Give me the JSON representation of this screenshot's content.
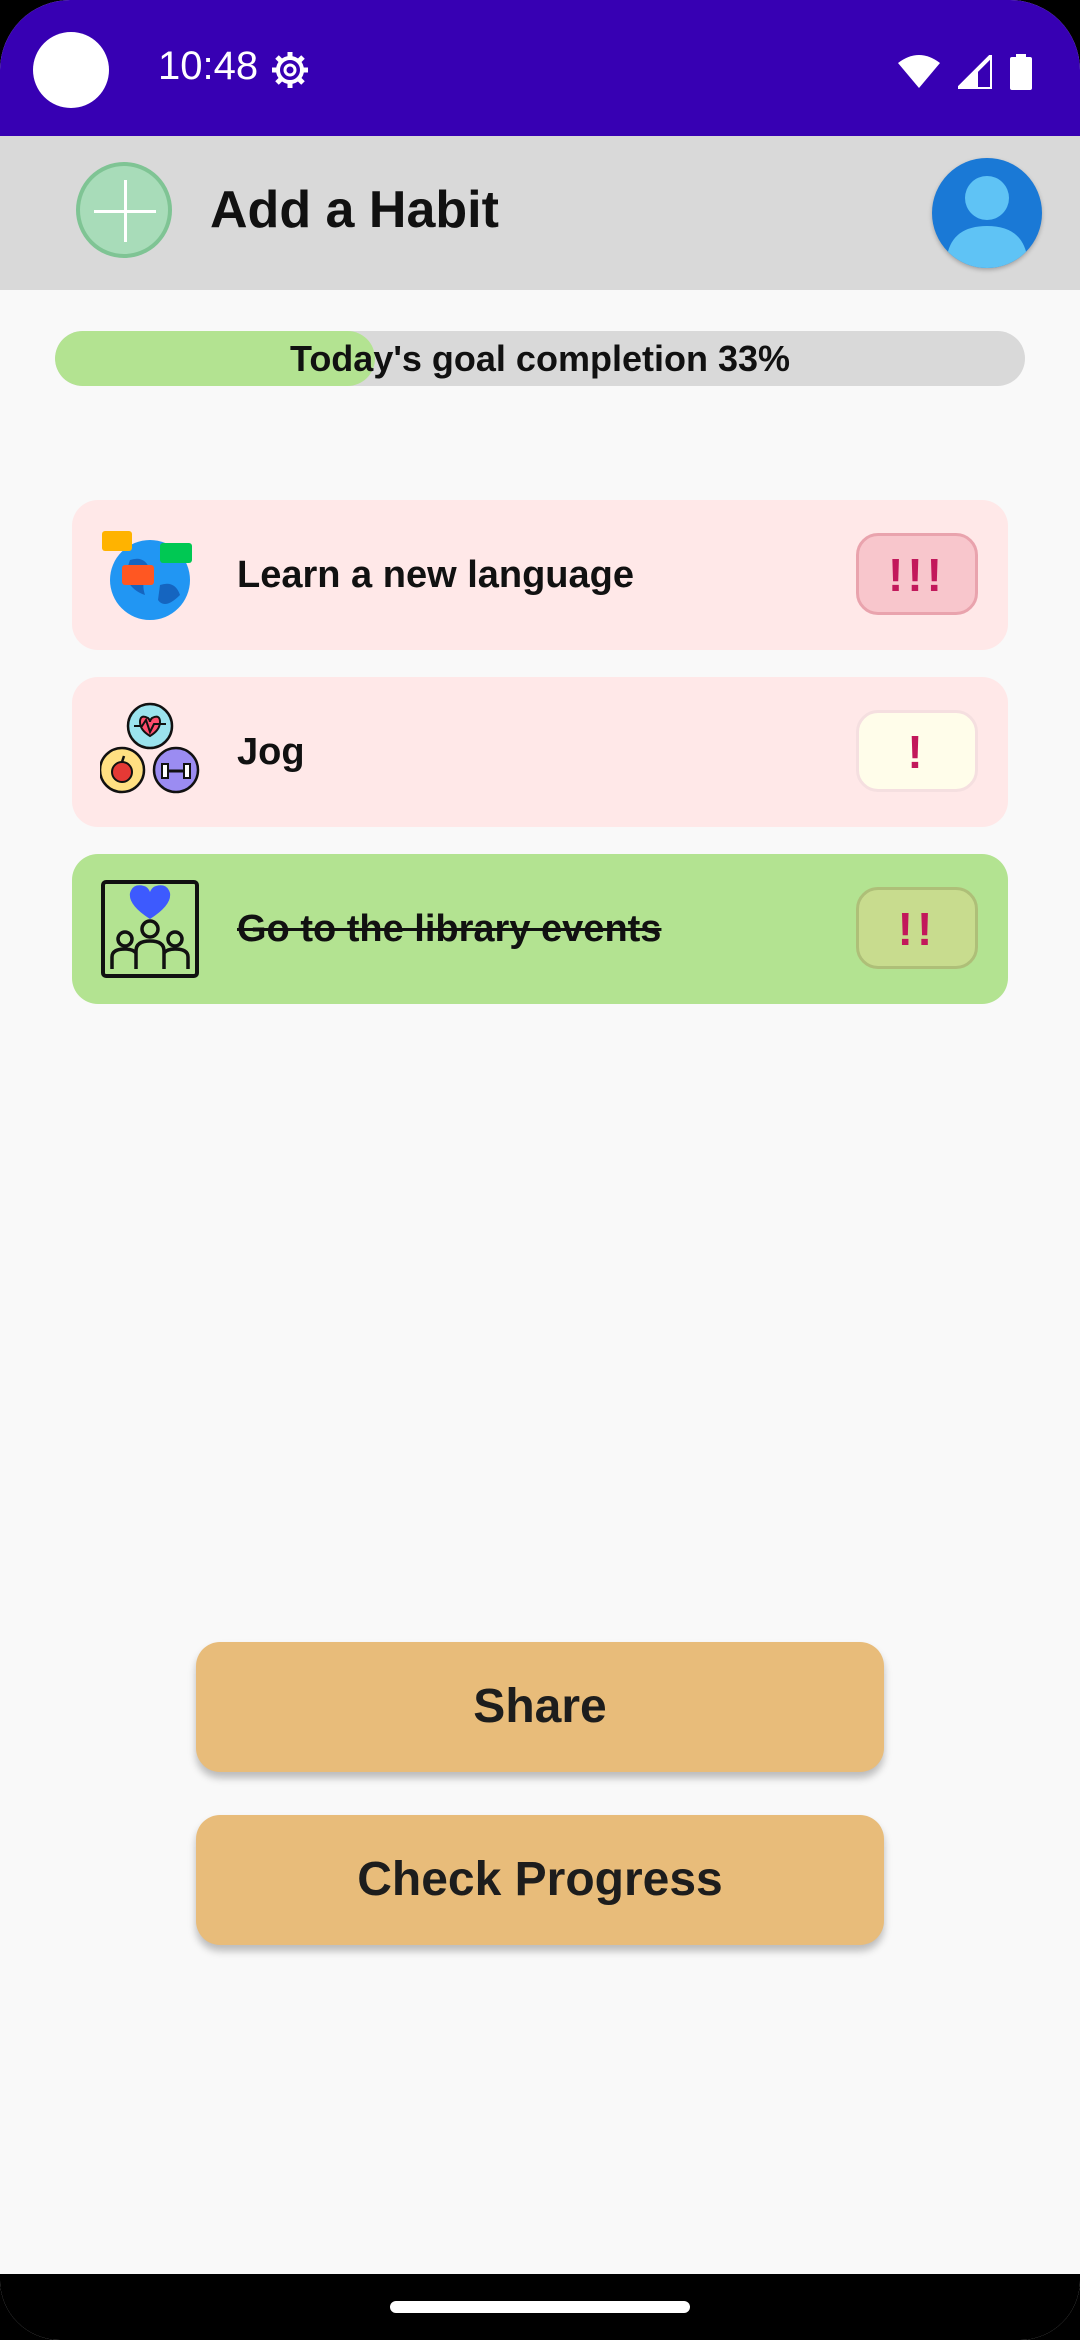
{
  "status_bar": {
    "time": "10:48",
    "icons": [
      "settings-gear-icon",
      "wifi-icon",
      "signal-icon",
      "battery-icon"
    ]
  },
  "app_bar": {
    "add_icon": "plus-icon",
    "title": "Add a Habit",
    "avatar_icon": "user-avatar-icon"
  },
  "progress": {
    "label": "Today's goal completion 33%",
    "value": 0.33,
    "fill_color": "#b3e391",
    "track_color": "#d9d9d9"
  },
  "habits": [
    {
      "title": "Learn a new language",
      "icon": "globe-language-icon",
      "priority": "!!!",
      "completed": false,
      "card_color": "#ffe8e8",
      "priority_bg": "#f8c6cc"
    },
    {
      "title": "Jog",
      "icon": "health-fitness-icon",
      "priority": "!",
      "completed": false,
      "card_color": "#ffe8e8",
      "priority_bg": "#fffdea"
    },
    {
      "title": "Go to the library events",
      "icon": "community-heart-icon",
      "priority": "!!",
      "completed": true,
      "card_color": "#b3e391",
      "priority_bg": "#c8dc8e"
    }
  ],
  "buttons": {
    "share": "Share",
    "check_progress": "Check Progress"
  },
  "colors": {
    "status_bar": "#3700b3",
    "button": "#e8bc7a",
    "priority_text": "#c2185b"
  }
}
